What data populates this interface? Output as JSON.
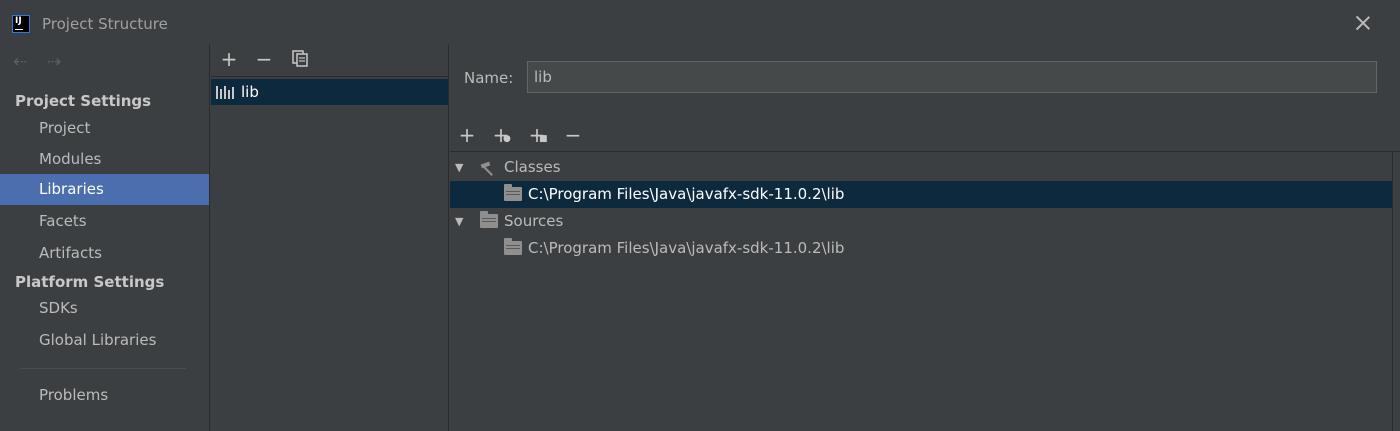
{
  "window": {
    "title": "Project Structure",
    "app_icon": "intellij-logo-icon",
    "close_icon": "close-icon"
  },
  "sidebar": {
    "back_icon": "arrow-left-icon",
    "forward_icon": "arrow-right-icon",
    "project_settings_heading": "Project Settings",
    "project_settings_items": [
      {
        "label": "Project"
      },
      {
        "label": "Modules"
      },
      {
        "label": "Libraries"
      },
      {
        "label": "Facets"
      },
      {
        "label": "Artifacts"
      }
    ],
    "platform_settings_heading": "Platform Settings",
    "platform_settings_items": [
      {
        "label": "SDKs"
      },
      {
        "label": "Global Libraries"
      }
    ],
    "problems_label": "Problems",
    "selected_item": "Libraries",
    "selected_color": "#4b6eaf"
  },
  "libraries_panel": {
    "toolbar": [
      {
        "icon": "plus-icon"
      },
      {
        "icon": "minus-icon"
      },
      {
        "icon": "copy-icon"
      }
    ],
    "items": [
      {
        "label": "lib",
        "icon": "library-icon"
      }
    ]
  },
  "library_detail": {
    "name_label": "Name:",
    "name_value": "lib",
    "toolbar": [
      {
        "icon": "plus-icon"
      },
      {
        "icon": "add-url-icon"
      },
      {
        "icon": "add-jar-icon"
      },
      {
        "icon": "minus-icon"
      }
    ],
    "tree": {
      "classes_label": "Classes",
      "classes_path": "C:\\Program Files\\Java\\javafx-sdk-11.0.2\\lib",
      "sources_label": "Sources",
      "sources_path": "C:\\Program Files\\Java\\javafx-sdk-11.0.2\\lib"
    }
  }
}
